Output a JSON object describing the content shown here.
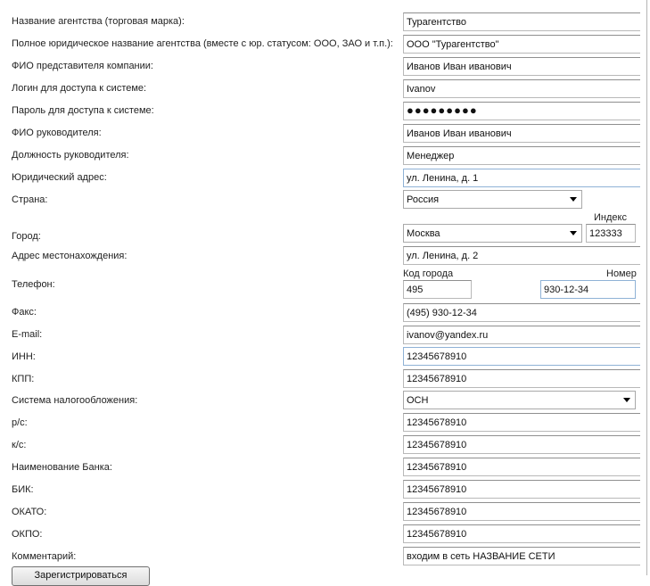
{
  "form": {
    "agency_name": {
      "label": "Название агентства (торговая марка):",
      "value": "Турагентство"
    },
    "legal_name": {
      "label": "Полное юридическое название агентства (вместе с юр. статусом: ООО, ЗАО и т.п.):",
      "value": "ООО \"Турагентство\""
    },
    "representative": {
      "label": "ФИО представителя компании:",
      "value": "Иванов Иван иванович"
    },
    "login": {
      "label": "Логин для доступа к системе:",
      "value": "Ivanov"
    },
    "password": {
      "label": "Пароль для доступа к системе:",
      "value": "●●●●●●●●●"
    },
    "director": {
      "label": "ФИО руководителя:",
      "value": "Иванов Иван иванович"
    },
    "director_position": {
      "label": "Должность руководителя:",
      "value": "Менеджер"
    },
    "legal_address": {
      "label": "Юридический адрес:",
      "value": "ул. Ленина, д. 1"
    },
    "country": {
      "label": "Страна:",
      "value": "Россия"
    },
    "city": {
      "label": "Город:",
      "value": "Москва",
      "index_caption": "Индекс",
      "index_value": "123333"
    },
    "actual_address": {
      "label": "Адрес местонахождения:",
      "value": "ул. Ленина, д. 2"
    },
    "phone": {
      "label": "Телефон:",
      "code_caption": "Код города",
      "code_value": "495",
      "number_caption": "Номер",
      "number_value": "930-12-34"
    },
    "fax": {
      "label": "Факс:",
      "value": "(495) 930-12-34"
    },
    "email": {
      "label": "E-mail:",
      "value": "ivanov@yandex.ru"
    },
    "inn": {
      "label": "ИНН:",
      "value": "12345678910"
    },
    "kpp": {
      "label": "КПП:",
      "value": "12345678910"
    },
    "tax_system": {
      "label": "Система налогообложения:",
      "value": "ОСН"
    },
    "rs": {
      "label": "р/с:",
      "value": "12345678910"
    },
    "ks": {
      "label": "к/с:",
      "value": "12345678910"
    },
    "bank_name": {
      "label": "Наименование Банка:",
      "value": "12345678910"
    },
    "bik": {
      "label": "БИК:",
      "value": "12345678910"
    },
    "okato": {
      "label": "ОКАТО:",
      "value": "12345678910"
    },
    "okpo": {
      "label": "ОКПО:",
      "value": "12345678910"
    },
    "comment": {
      "label": "Комментарий:",
      "value": "входим в сеть НАЗВАНИЕ СЕТИ"
    }
  },
  "submit": {
    "label": "Зарегистрироваться"
  }
}
